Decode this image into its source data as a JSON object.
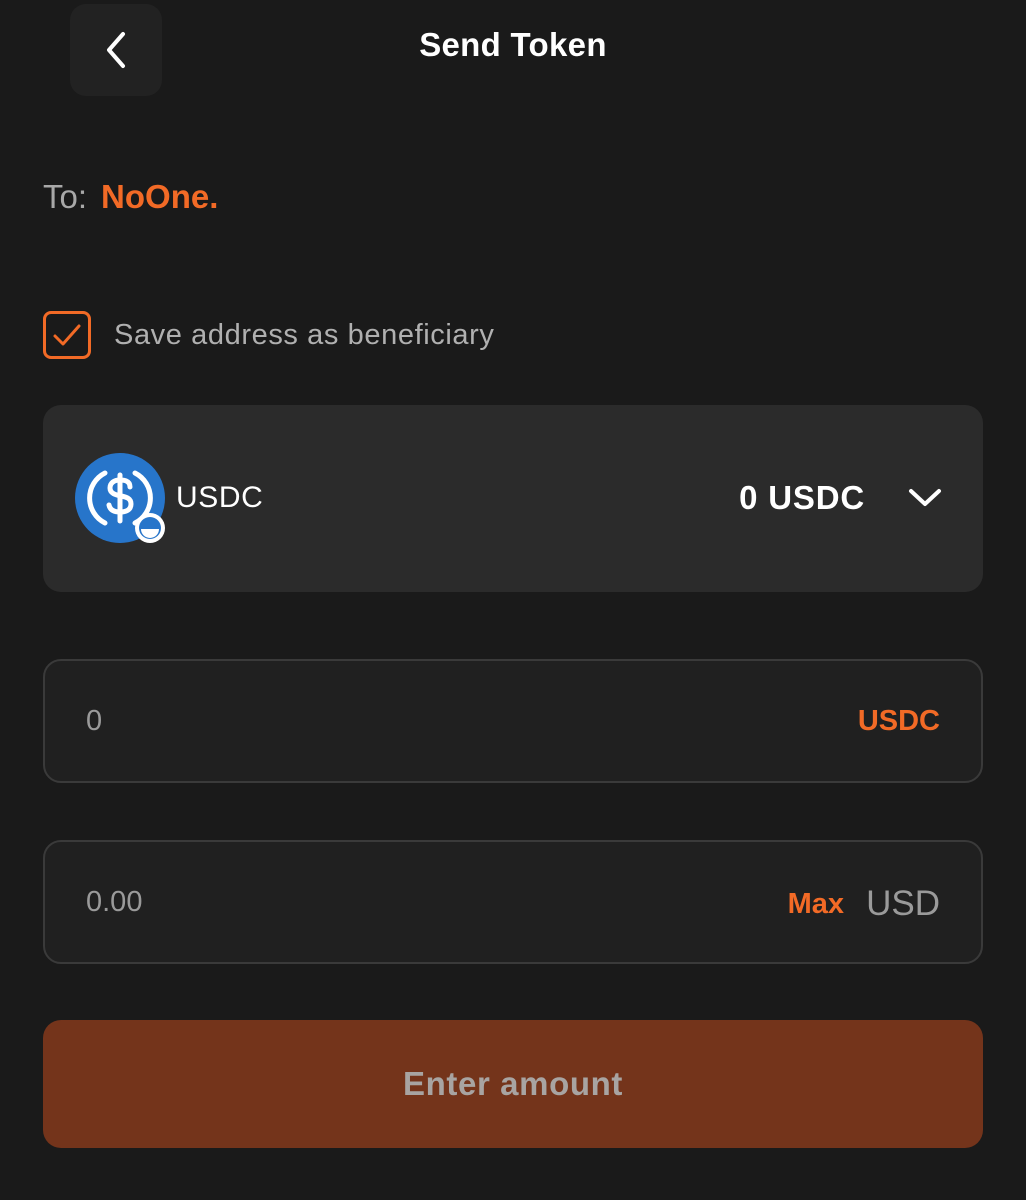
{
  "header": {
    "title": "Send Token",
    "back_icon": "chevron-left-icon"
  },
  "recipient": {
    "label": "To:",
    "name": "NoOne."
  },
  "save_beneficiary": {
    "checked": true,
    "label": "Save address as beneficiary"
  },
  "token_selector": {
    "icon": "usdc-coin-icon",
    "name": "USDC",
    "balance": "0 USDC",
    "dropdown_icon": "chevron-down-icon"
  },
  "token_amount": {
    "value": "",
    "placeholder": "0",
    "unit": "USDC"
  },
  "fiat_amount": {
    "value": "",
    "placeholder": "0.00",
    "max_label": "Max",
    "unit": "USD"
  },
  "submit": {
    "label": "Enter amount",
    "enabled": false
  },
  "colors": {
    "background": "#1a1a1a",
    "accent": "#f26a26",
    "button_disabled": "#74341b",
    "card": "#2b2b2b",
    "usdc_blue": "#2775ca"
  }
}
